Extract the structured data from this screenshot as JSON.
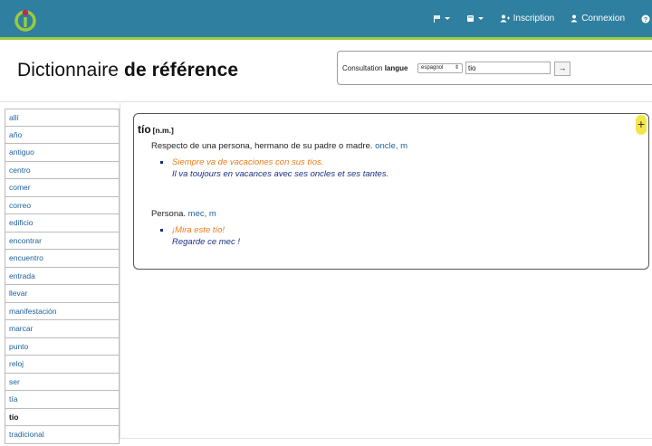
{
  "navbar": {
    "items": [
      {
        "name": "flag-menu",
        "label": ""
      },
      {
        "name": "book-menu",
        "label": ""
      },
      {
        "name": "signup",
        "label": "Inscription"
      },
      {
        "name": "login",
        "label": "Connexion"
      }
    ],
    "colors": {
      "bg": "#2f7fa0",
      "accent": "#9acb3c"
    }
  },
  "header": {
    "title_light": "Dictionnaire ",
    "title_bold": "de référence"
  },
  "search": {
    "label_prefix": "Consultation ",
    "label_bold": "langue",
    "language": "espagnol",
    "value": "tio",
    "submit": "→"
  },
  "sidebar": {
    "items": [
      {
        "label": "allí",
        "active": false
      },
      {
        "label": "año",
        "active": false
      },
      {
        "label": "antiguo",
        "active": false
      },
      {
        "label": "centro",
        "active": false
      },
      {
        "label": "comer",
        "active": false
      },
      {
        "label": "correo",
        "active": false
      },
      {
        "label": "edificio",
        "active": false
      },
      {
        "label": "encontrar",
        "active": false
      },
      {
        "label": "encuentro",
        "active": false
      },
      {
        "label": "entrada",
        "active": false
      },
      {
        "label": "llevar",
        "active": false
      },
      {
        "label": "manifestación",
        "active": false
      },
      {
        "label": "marcar",
        "active": false
      },
      {
        "label": "punto",
        "active": false
      },
      {
        "label": "reloj",
        "active": false
      },
      {
        "label": "ser",
        "active": false
      },
      {
        "label": "tía",
        "active": false
      },
      {
        "label": "tío",
        "active": true
      },
      {
        "label": "tradicional",
        "active": false
      }
    ]
  },
  "entry": {
    "word": "tío",
    "grammar": "[n.m.]",
    "plus": "+",
    "senses": [
      {
        "definition": "Respecto de una persona, hermano de su padre o madre. ",
        "translations": "oncle, m",
        "example_es": "Siempre va de vacaciones con sus tíos.",
        "example_fr": "Il va toujours en vacances avec ses oncles et ses tantes."
      },
      {
        "definition": "Persona. ",
        "translations": "mec, m",
        "example_es": "¡Mira este tío!",
        "example_fr": "Regarde ce mec !"
      }
    ]
  }
}
